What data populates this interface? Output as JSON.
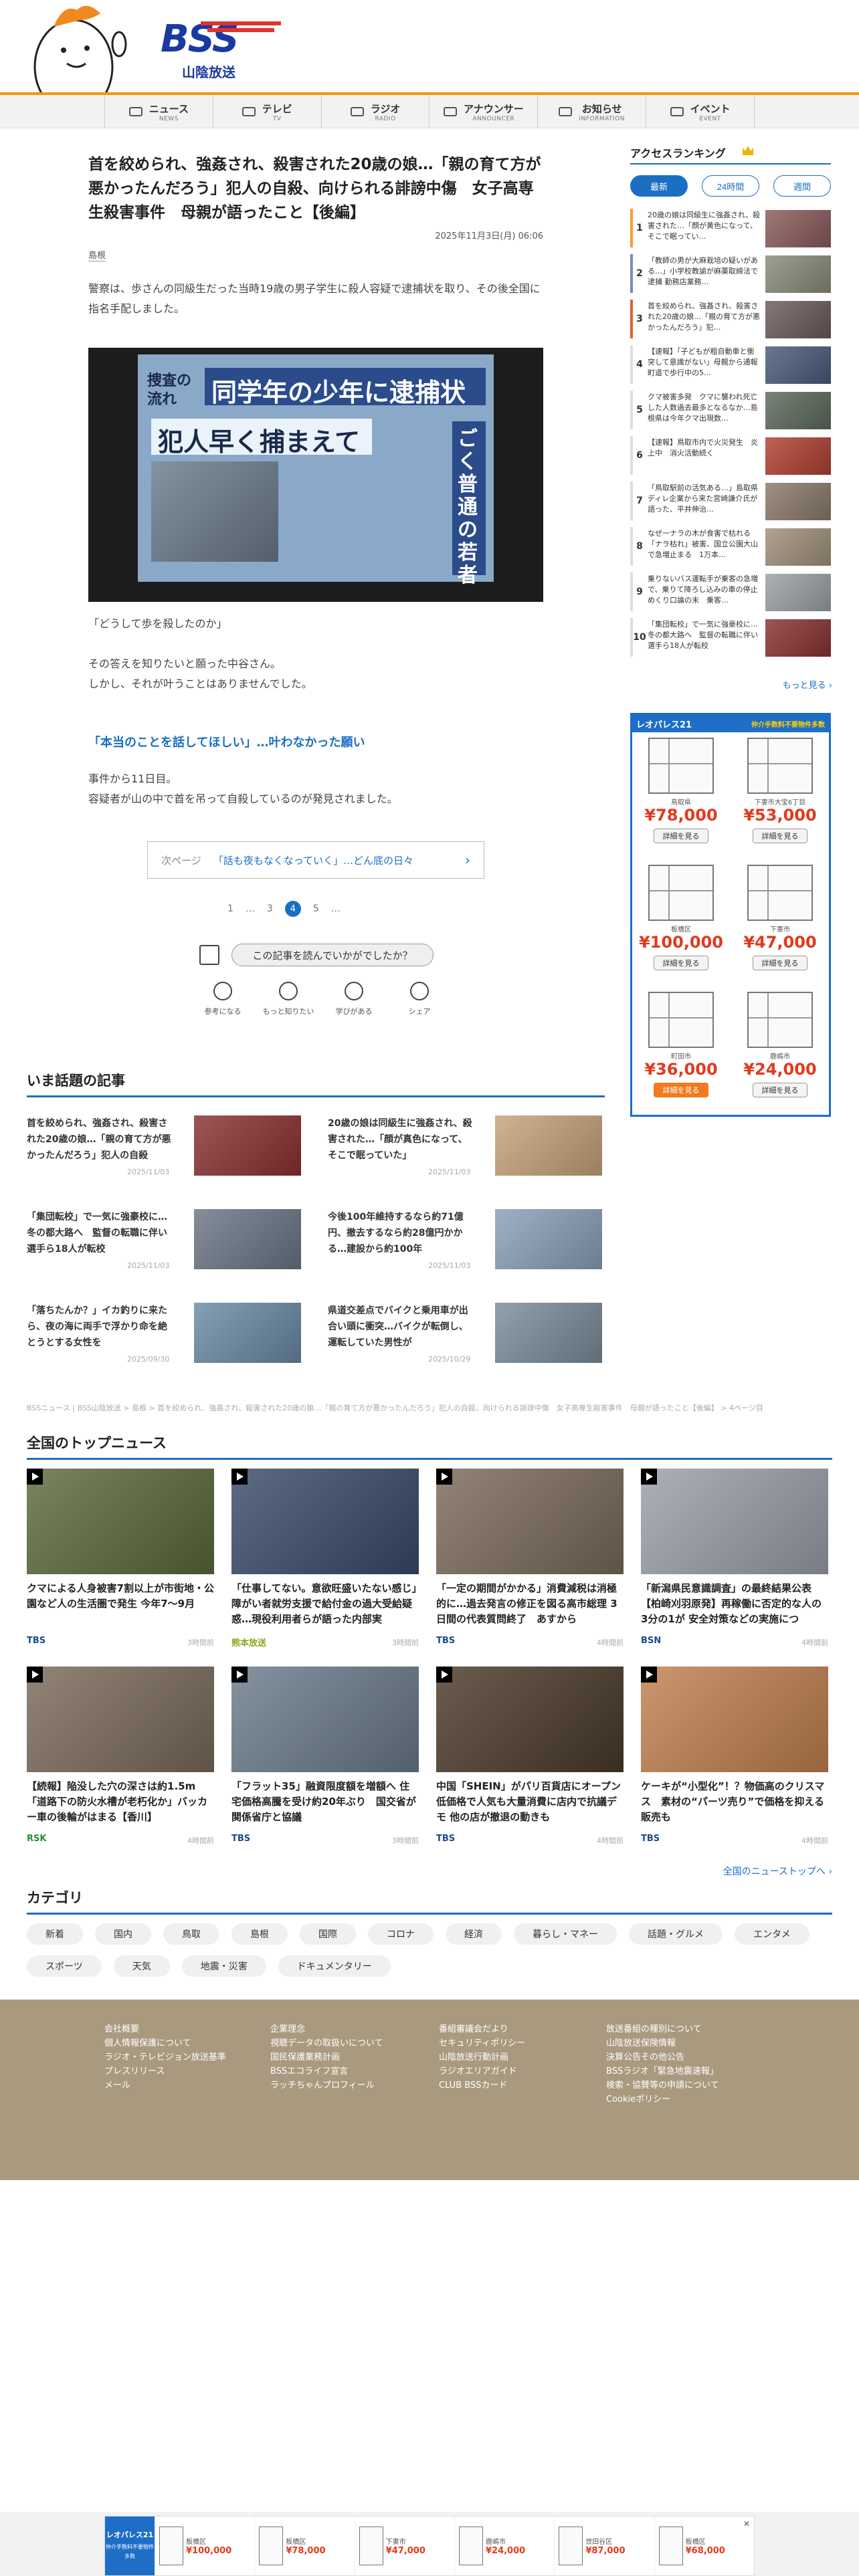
{
  "header": {
    "logo_text": "BSS",
    "station_name": "山陰放送"
  },
  "nav": [
    {
      "jp": "ニュース",
      "en": "NEWS",
      "icon": "news-icon"
    },
    {
      "jp": "テレビ",
      "en": "TV",
      "icon": "tv-icon"
    },
    {
      "jp": "ラジオ",
      "en": "RADIO",
      "icon": "radio-icon"
    },
    {
      "jp": "アナウンサー",
      "en": "ANNOUNCER",
      "icon": "microphone-icon"
    },
    {
      "jp": "お知らせ",
      "en": "INFORMATION",
      "icon": "megaphone-icon"
    },
    {
      "jp": "イベント",
      "en": "EVENT",
      "icon": "ticket-icon"
    }
  ],
  "article": {
    "title": "首を絞められ、強姦され、殺害された20歳の娘…「親の育て方が悪かったんだろう」犯人の自殺、向けられる誹謗中傷　女子高専生殺害事件　母親が語ったこと【後編】",
    "date": "2025年11月3日(月) 06:06",
    "category": "島根",
    "para1": "警察は、歩さんの同級生だった当時19歳の男子学生に殺人容疑で逮捕状を取り、その後全国に指名手配しました。",
    "quote": "「どうして歩を殺したのか」",
    "para2a": "その答えを知りたいと願った中谷さん。",
    "para2b": "しかし、それが叶うことはありませんでした。",
    "subhead": "「本当のことを話してほしい」…叶わなかった願い",
    "para3a": "事件から11日目。",
    "para3b": "容疑者が山の中で首を吊って自殺しているのが発見されました。",
    "photo_text": {
      "banner": "同学年の少年に逮捕状",
      "left": "捜査の流れ",
      "big": "犯人早く捕まえて",
      "side": "ごく普通の若者"
    },
    "next_label": "次ページ",
    "next_title": "「話も夜もなくなっていく」…どん底の日々",
    "pager": [
      "1",
      "…",
      "3",
      "4",
      "5",
      "…"
    ],
    "feedback_q": "この記事を読んでいかがでしたか？",
    "reactions": [
      "参考になる",
      "もっと知りたい",
      "学びがある",
      "シェア"
    ]
  },
  "trending": {
    "title": "いま話題の記事",
    "items": [
      {
        "title": "首を絞められ、強姦され、殺害された20歳の娘…「親の育て方が悪かったんだろう」犯人の自殺",
        "date": "2025/11/03"
      },
      {
        "title": "20歳の娘は同級生に強姦され、殺害された…「顔が真色になって、そこで眠っていた」",
        "date": "2025/11/03"
      },
      {
        "title": "「集団転校」で一気に強豪校に…冬の都大路へ　監督の転職に伴い選手ら18人が転校",
        "date": "2025/11/03"
      },
      {
        "title": "今後100年維持するなら約71億円、撤去するなら約28億円かかる…建設から約100年",
        "date": "2025/11/03"
      },
      {
        "title": "「落ちたんか？」イカ釣りに来たら、夜の海に両手で浮かり命を絶とうとする女性を",
        "date": "2025/09/30"
      },
      {
        "title": "県道交差点でバイクと乗用車が出合い頭に衝突…バイクが転倒し、運転していた男性が",
        "date": "2025/10/29"
      }
    ]
  },
  "breadcrumb": "BSSニュース | BSS山陰放送 > 島根 > 首を絞められ、強姦され、殺害された20歳の娘…「親の育て方が悪かったんだろう」犯人の自殺、向けられる誹謗中傷　女子高専生殺害事件　母親が語ったこと【後編】 > 4ページ目",
  "topnews": {
    "title": "全国のトップニュース",
    "items": [
      {
        "title": "クマによる人身被害7割以上が市街地・公園など人の生活圏で発生 今年7〜9月",
        "source": "TBS",
        "time": "3時間前",
        "color": "#1a4a8a"
      },
      {
        "title": "「仕事してない。意欲旺盛いたない感じ」障がい者就労支援で給付金の過大受給疑惑…現役利用者らが語った内部実",
        "source": "熊本放送",
        "time": "3時間前",
        "color": "#86a81e"
      },
      {
        "title": "「一定の期間がかかる」消費減税は消極的に…過去発言の修正を図る高市総理 3日間の代表質問終了　あすから",
        "source": "TBS",
        "time": "4時間前",
        "color": "#1a4a8a"
      },
      {
        "title": "「新潟県民意識調査」の最終結果公表【柏崎刈羽原発】再稼働に否定的な人の3分の1が 安全対策などの実施につ",
        "source": "BSN",
        "time": "4時間前",
        "color": "#1a4a8a"
      },
      {
        "title": "【続報】陥没した穴の深さは約1.5m「道路下の防火水槽が老朽化か」バッカー車の後輪がはまる【香川】",
        "source": "RSK",
        "time": "4時間前",
        "color": "#2a8a3a"
      },
      {
        "title": "「フラット35」融資限度額を増額へ 住宅価格高騰を受け約20年ぶり　国交省が関係省庁と協議",
        "source": "TBS",
        "time": "3時間前",
        "color": "#1a4a8a"
      },
      {
        "title": "中国「SHEIN」がパリ百貨店にオープン　低価格で人気も大量消費に店内で抗議デモ 他の店が撤退の動きも",
        "source": "TBS",
        "time": "4時間前",
        "color": "#1a4a8a"
      },
      {
        "title": "ケーキが“小型化”！？物価高のクリスマス　素材の“パーツ売り”で価格を抑える販売も",
        "source": "TBS",
        "time": "4時間前",
        "color": "#1a4a8a"
      }
    ],
    "more": "全国のニューストップへ"
  },
  "categories": {
    "title": "カテゴリ",
    "items": [
      "新着",
      "国内",
      "鳥取",
      "島根",
      "国際",
      "コロナ",
      "経済",
      "暮らし・マネー",
      "話題・グルメ",
      "エンタメ",
      "スポーツ",
      "天気",
      "地震・災害",
      "ドキュメンタリー"
    ]
  },
  "footer": {
    "col1": [
      "会社概要",
      "個人情報保護について",
      "ラジオ・テレビジョン放送基準",
      "プレスリリース",
      "メール"
    ],
    "col2": [
      "企業理念",
      "視聴データの取扱いについて",
      "国民保護業務計画",
      "BSSエコライフ宣言",
      "ラッチちゃんプロフィール"
    ],
    "col3": [
      "番組審議会だより",
      "セキュリティポリシー",
      "山陰放送行動計画",
      "ラジオエリアガイド",
      "CLUB BSSカード"
    ],
    "col4": [
      "放送番組の種別について",
      "山陰放送保険情報",
      "決算公告その他公告",
      "BSSラジオ「緊急地震速報」",
      "検索・協賛等の申請について",
      "Cookieポリシー"
    ]
  },
  "ranking": {
    "title": "アクセスランキング",
    "tabs": [
      "最新",
      "24時間",
      "週間"
    ],
    "items": [
      {
        "n": "1",
        "title": "20歳の娘は同級生に強姦され、殺害された…「顔が黄色になって、そこで眠ってい…"
      },
      {
        "n": "2",
        "title": "「教師の男が大麻栽培の疑いがある…」小学校教諭が麻薬取締法で逮捕 勤務店業務…"
      },
      {
        "n": "3",
        "title": "首を絞められ、強姦され、殺害された20歳の娘…「親の育て方が悪かったんだろう」犯…"
      },
      {
        "n": "4",
        "title": "【速報】「子どもが粗自動車と衝突して意識がない」母親から通報　町道で歩行中の5…"
      },
      {
        "n": "5",
        "title": "クマ被害多発　クマに襲われ死亡した人数過去最多となるなか…島根県は今年クマ出現数…"
      },
      {
        "n": "6",
        "title": "【速報】鳥取市内で火災発生　炎上中　消火活動続く"
      },
      {
        "n": "7",
        "title": "「鳥取駅前の活気ある…」島取県ディレ企業から来た宮崎謙介氏が語った、平井伸治…"
      },
      {
        "n": "8",
        "title": "なぜ一ナラの木が食害で枯れる「ナラ枯れ」被害、国立公園大山で急増止まる　1万本…"
      },
      {
        "n": "9",
        "title": "乗りないバス運転手が乗客の急増で、乗りて降ろし込みの車の停止めくり口論の末　乗客…"
      },
      {
        "n": "10",
        "title": "「集団転校」で一気に強豪校に…冬の都大路へ　監督の転職に伴い選手ら18人が転校"
      }
    ],
    "more": "もっと見る"
  },
  "ad": {
    "brand": "レオパレス21",
    "tagline": "仲介手数料不要物件多数",
    "cells": [
      {
        "loc": "鳥取県",
        "price": "¥78,000",
        "btn": "詳細を見る"
      },
      {
        "loc": "下妻市大宝6丁目",
        "price": "¥53,000",
        "btn": "詳細を見る"
      },
      {
        "loc": "板橋区",
        "price": "¥100,000",
        "btn": "詳細を見る"
      },
      {
        "loc": "下妻市",
        "price": "¥47,000",
        "btn": "詳細を見る"
      },
      {
        "loc": "町田市",
        "price": "¥36,000",
        "btn": "詳細を見る"
      },
      {
        "loc": "鹿嶋市",
        "price": "¥24,000",
        "btn": "詳細を見る"
      }
    ]
  },
  "bottom_ad": {
    "logo": "レオパレス21",
    "sub": "仲介手数料不要物件多数",
    "cells": [
      {
        "l": "板橋区",
        "p": "¥100,000"
      },
      {
        "l": "板橋区",
        "p": "¥78,000"
      },
      {
        "l": "下妻市",
        "p": "¥47,000"
      },
      {
        "l": "鹿嶋市",
        "p": "¥24,000"
      },
      {
        "l": "世田谷区",
        "p": "¥87,000"
      },
      {
        "l": "板橋区",
        "p": "¥68,000"
      }
    ],
    "close": "✕"
  }
}
